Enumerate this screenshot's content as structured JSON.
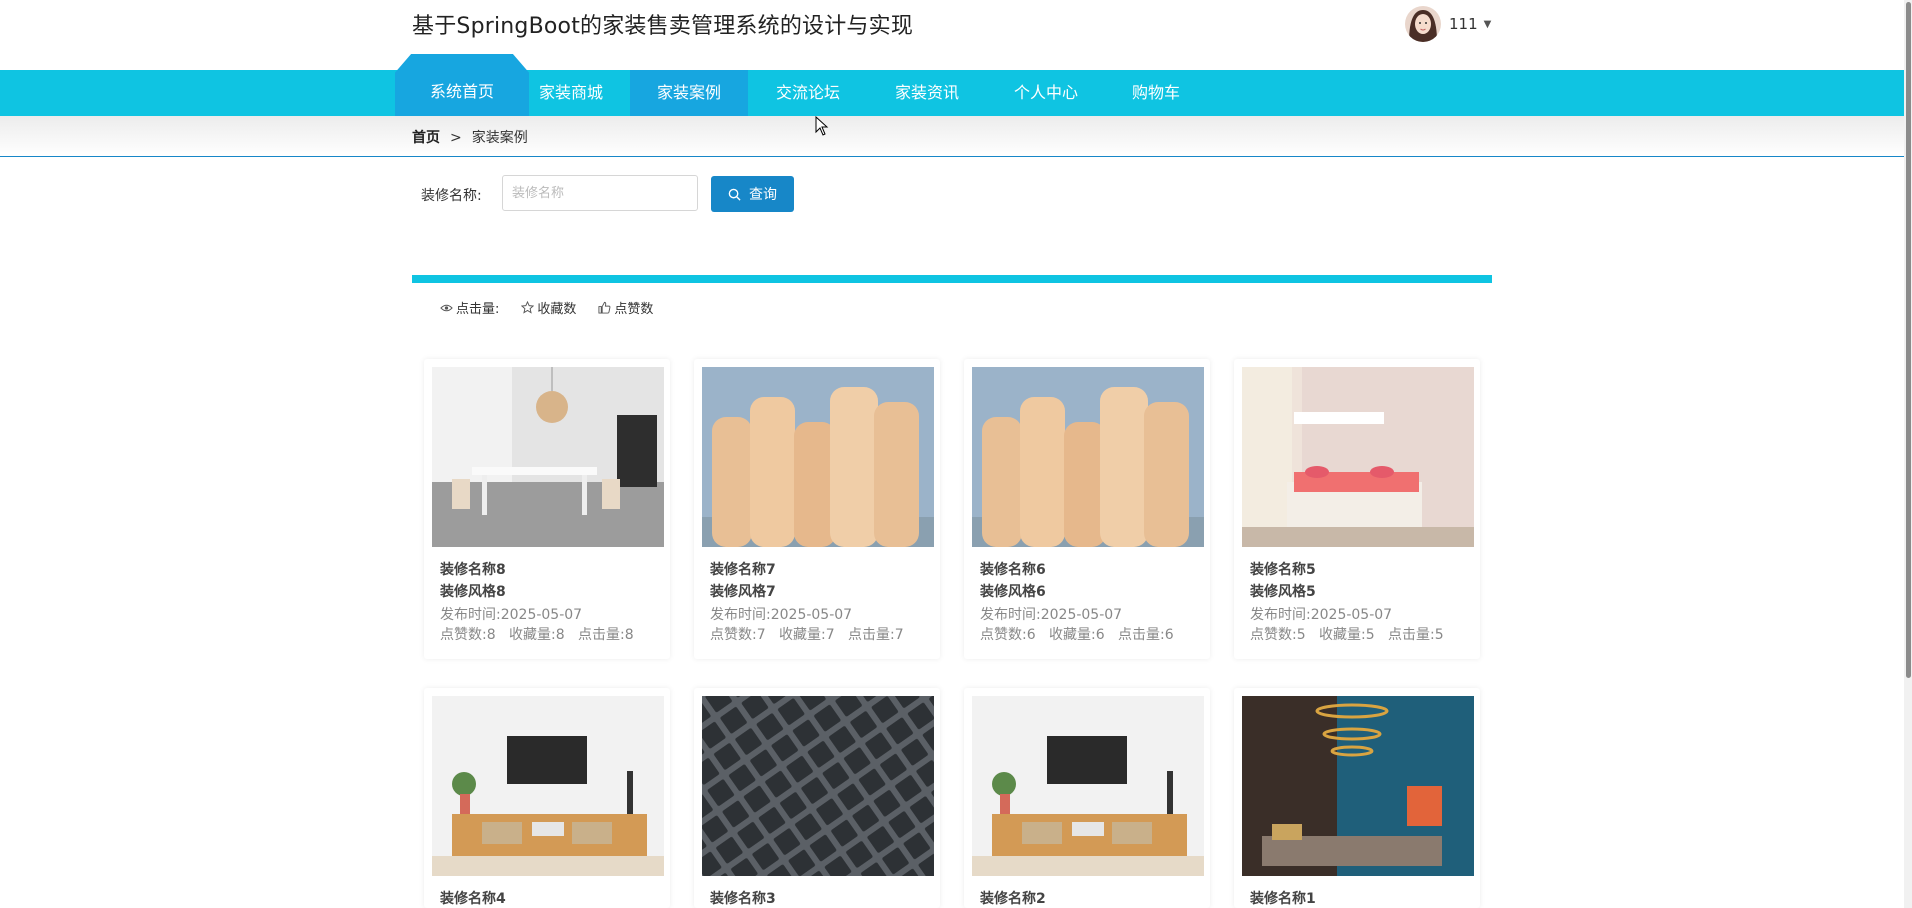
{
  "site_title": "基于SpringBoot的家装售卖管理系统的设计与实现",
  "user": {
    "name": "111",
    "avatar_icon": "user-avatar"
  },
  "nav": {
    "items": [
      "系统首页",
      "家装商城",
      "家装案例",
      "交流论坛",
      "家装资讯",
      "个人中心",
      "购物车"
    ],
    "active": "家装案例",
    "color": "#0fc4e2",
    "active_color": "#17a6e0"
  },
  "breadcrumb": {
    "home": "首页",
    "separator": ">",
    "current": "家装案例"
  },
  "search": {
    "label": "装修名称:",
    "placeholder": "装修名称",
    "value": "",
    "button": "查询"
  },
  "sort": {
    "click_label": "点击量:",
    "fav_label": "收藏数",
    "like_label": "点赞数"
  },
  "cards": [
    {
      "name": "装修名称8",
      "style": "装修风格8",
      "date_label": "发布时间:",
      "date": "2025-05-07",
      "likes": 8,
      "favs": 8,
      "clicks": 8,
      "image": "dining-room"
    },
    {
      "name": "装修名称7",
      "style": "装修风格7",
      "date_label": "发布时间:",
      "date": "2025-05-07",
      "likes": 7,
      "favs": 7,
      "clicks": 7,
      "image": "rattan-rolls"
    },
    {
      "name": "装修名称6",
      "style": "装修风格6",
      "date_label": "发布时间:",
      "date": "2025-05-07",
      "likes": 6,
      "favs": 6,
      "clicks": 6,
      "image": "rattan-rolls"
    },
    {
      "name": "装修名称5",
      "style": "装修风格5",
      "date_label": "发布时间:",
      "date": "2025-05-07",
      "likes": 5,
      "favs": 5,
      "clicks": 5,
      "image": "bedroom"
    },
    {
      "name": "装修名称4",
      "image": "tv-cabinet"
    },
    {
      "name": "装修名称3",
      "image": "dark-tiles"
    },
    {
      "name": "装修名称2",
      "image": "tv-cabinet"
    },
    {
      "name": "装修名称1",
      "image": "living-room-chandelier"
    }
  ],
  "stat_labels": {
    "likes": "点赞数:",
    "favs": "收藏量:",
    "clicks": "点击量:"
  }
}
